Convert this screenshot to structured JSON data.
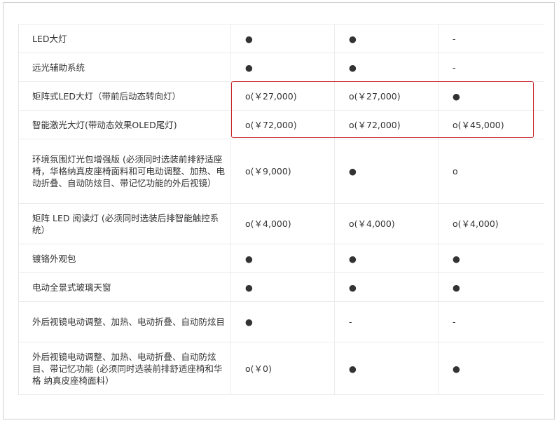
{
  "rows": [
    {
      "feature": "LED大灯",
      "v1": "●",
      "v2": "●",
      "v3": "-"
    },
    {
      "feature": "远光辅助系统",
      "v1": "●",
      "v2": "●",
      "v3": "-"
    },
    {
      "feature": "矩阵式LED大灯（带前后动态转向灯）",
      "v1": "o(￥27,000)",
      "v2": "o(￥27,000)",
      "v3": "●"
    },
    {
      "feature": "智能激光大灯(带动态效果OLED尾灯)",
      "v1": "o(￥72,000)",
      "v2": "o(￥72,000)",
      "v3": "o(￥45,000)"
    },
    {
      "feature": "环境氛围灯光包增强版 (必须同时选装前排舒适座椅，华格纳真皮座椅面料和可电动调整、加热、电 动折叠、自动防炫目、带记忆功能的外后视镜）",
      "v1": "o(￥9,000)",
      "v2": "●",
      "v3": "o"
    },
    {
      "feature": "矩阵 LED 阅读灯 (必须同时选装后排智能触控系统）",
      "v1": "o(￥4,000)",
      "v2": "o(￥4,000)",
      "v3": "o(￥4,000)"
    },
    {
      "feature": "镀铬外观包",
      "v1": "●",
      "v2": "●",
      "v3": "●"
    },
    {
      "feature": "电动全景式玻璃天窗",
      "v1": "●",
      "v2": "●",
      "v3": "●"
    },
    {
      "feature": "外后视镜电动调整、加热、电动折叠、自动防炫目",
      "v1": "●",
      "v2": "-",
      "v3": "-"
    },
    {
      "feature": "外后视镜电动调整、加热、电动折叠、自动防炫目、带记忆功能 (必须同时选装前排舒适座椅和华格 纳真皮座椅面料）",
      "v1": "o(￥0)",
      "v2": "●",
      "v3": "●"
    }
  ],
  "highlight_color": "#c8262c"
}
